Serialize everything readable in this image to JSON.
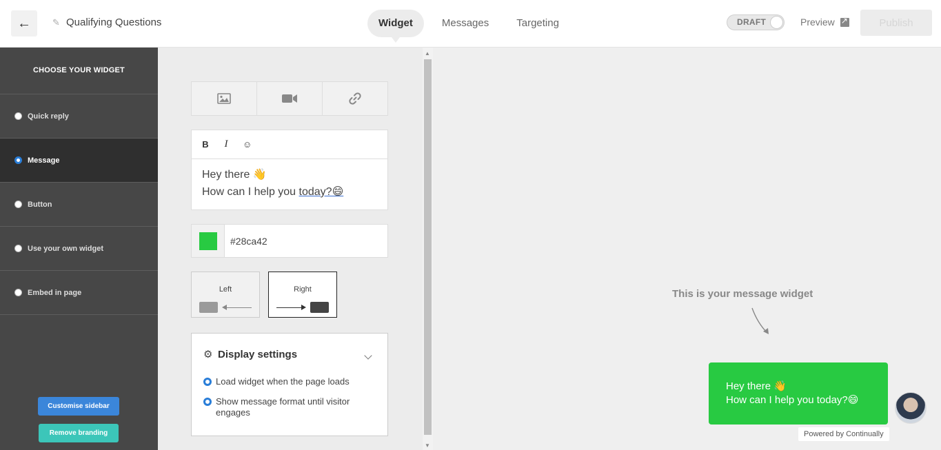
{
  "header": {
    "back_icon": "arrow-left-icon",
    "title": "Qualifying Questions",
    "tabs": [
      {
        "label": "Widget"
      },
      {
        "label": "Messages"
      },
      {
        "label": "Targeting"
      }
    ],
    "draft_label": "DRAFT",
    "preview_label": "Preview",
    "publish_label": "Publish"
  },
  "sidebar": {
    "heading": "CHOOSE YOUR WIDGET",
    "items": [
      {
        "label": "Quick reply"
      },
      {
        "label": "Message"
      },
      {
        "label": "Button"
      },
      {
        "label": "Use your own widget"
      },
      {
        "label": "Embed in page"
      }
    ],
    "customise_label": "Customise sidebar",
    "remove_branding_label": "Remove branding"
  },
  "editor": {
    "media_buttons": [
      "image-icon",
      "video-icon",
      "link-icon"
    ],
    "format_buttons": [
      "B",
      "I",
      "☺"
    ],
    "message_line1": "Hey there 👋",
    "message_line2_start": "How can I help you ",
    "message_line2_link": "today?😄",
    "color_value": "#28ca42",
    "position_left_label": "Left",
    "position_right_label": "Right",
    "display_settings_title": "Display settings",
    "option_load": "Load widget when the page loads",
    "option_show": "Show message format until visitor engages"
  },
  "preview": {
    "hint": "This is your message widget",
    "bubble_line1": "Hey there 👋",
    "bubble_line2": "How can I help you today?😄",
    "powered_by": "Powered by Continually"
  },
  "colors": {
    "accent_green": "#28ca42",
    "sidebar_bg": "#474747",
    "blue": "#3b86da",
    "teal": "#3cc6b9"
  }
}
